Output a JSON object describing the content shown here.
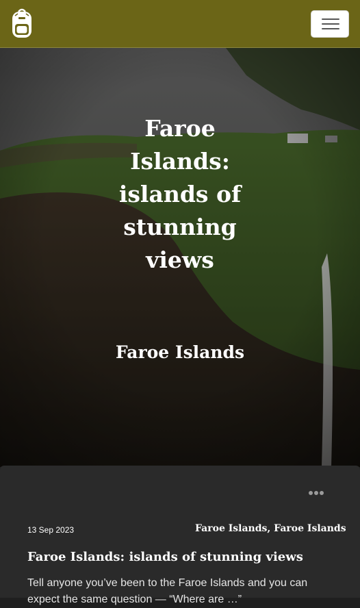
{
  "navbar": {
    "logo_icon": "backpack-icon",
    "menu_icon": "hamburger-icon",
    "background": "#6b6517"
  },
  "hero": {
    "title": "Faroe Islands: islands of stunning views",
    "subtitle": "Faroe Islands"
  },
  "post": {
    "date": "13 Sep 2023",
    "tag1": "Faroe Islands",
    "separator": ", ",
    "tag2": "Faroe Islands",
    "title": "Faroe Islands: islands of stunning views",
    "excerpt": "Tell anyone you’ve been to the Faroe Islands and you can expect the same question — “Where are …”",
    "menu_icon": "more-dots-icon"
  }
}
